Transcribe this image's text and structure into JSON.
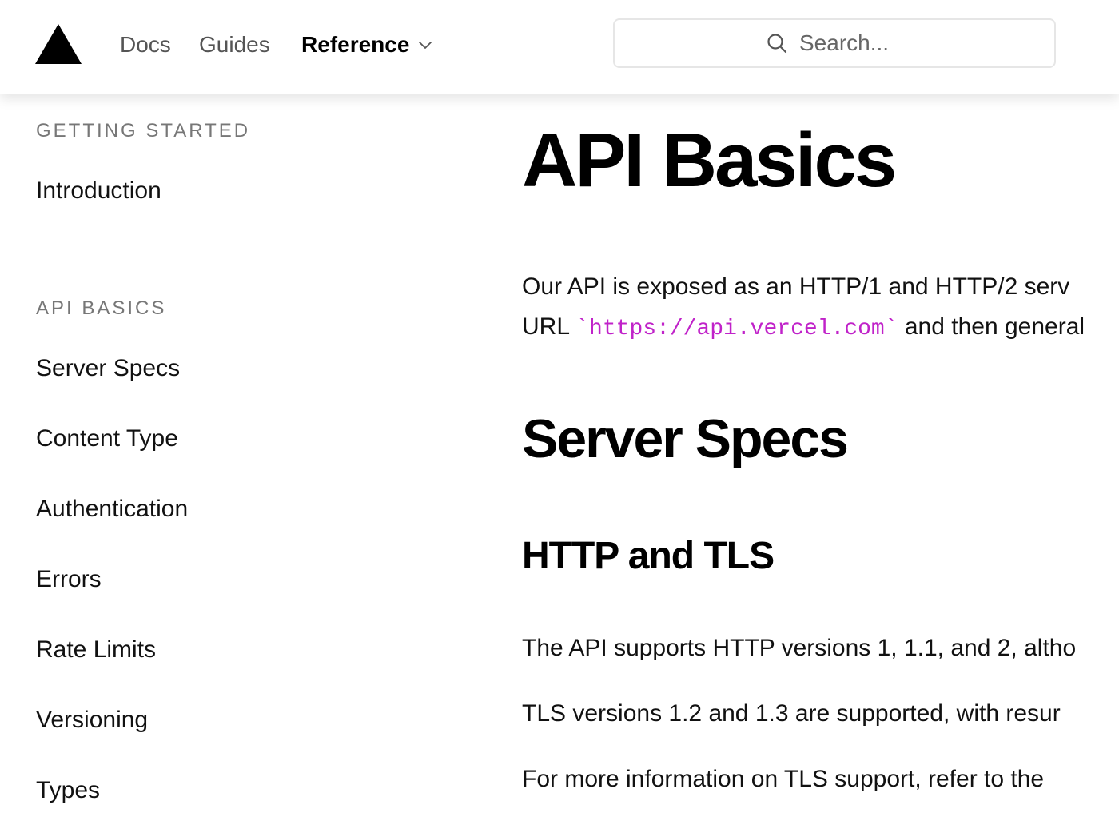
{
  "header": {
    "logo_icon": "triangle-logo-icon",
    "nav": {
      "docs": "Docs",
      "guides": "Guides",
      "reference": "Reference"
    },
    "search": {
      "placeholder": "Search..."
    }
  },
  "sidebar": {
    "sections": [
      {
        "title": "GETTING STARTED",
        "items": [
          "Introduction"
        ]
      },
      {
        "title": "API BASICS",
        "items": [
          "Server Specs",
          "Content Type",
          "Authentication",
          "Errors",
          "Rate Limits",
          "Versioning",
          "Types"
        ]
      }
    ]
  },
  "main": {
    "title": "API Basics",
    "intro_line1": "Our API is exposed as an HTTP/1 and HTTP/2 serv",
    "intro_line2_prefix": "URL ",
    "intro_code": "`https://api.vercel.com`",
    "intro_line2_suffix": " and then general",
    "section_heading": "Server Specs",
    "subsection_heading": "HTTP and TLS",
    "para_http": "The API supports HTTP versions 1, 1.1, and 2, altho",
    "para_tls": "TLS versions 1.2 and 1.3 are supported, with resur",
    "para_more": "For more information on TLS support, refer to the"
  },
  "colors": {
    "code": "#c022c9",
    "muted": "#777777",
    "nav_inactive": "#555555",
    "border": "#e6e6e6"
  }
}
